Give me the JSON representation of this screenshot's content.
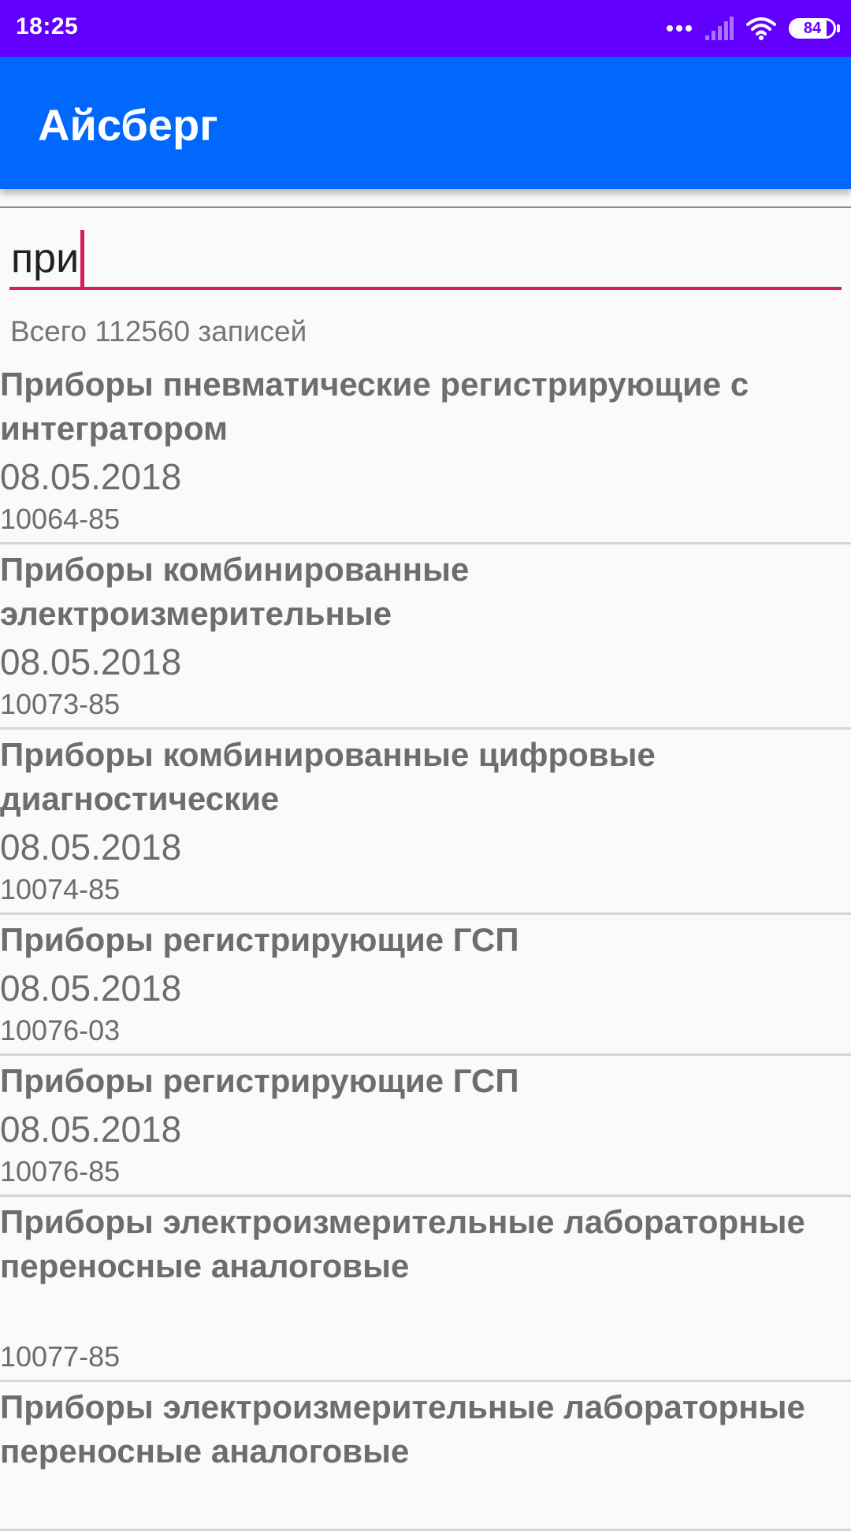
{
  "status_bar": {
    "time": "18:25",
    "battery": "84",
    "battery_level": 0.84,
    "icons": [
      "more-dots-icon",
      "signal-icon",
      "wifi-icon",
      "battery-icon"
    ]
  },
  "app_bar": {
    "title": "Айсберг"
  },
  "search": {
    "value": "при"
  },
  "results": {
    "total_label": "Всего 112560 записей"
  },
  "items": [
    {
      "title": "Приборы пневматические регистрирующие с интегратором",
      "date": "08.05.2018",
      "code": "10064-85"
    },
    {
      "title": "Приборы комбинированные электроизмерительные",
      "date": "08.05.2018",
      "code": "10073-85"
    },
    {
      "title": "Приборы комбинированные цифровые диагностические",
      "date": "08.05.2018",
      "code": "10074-85"
    },
    {
      "title": "Приборы регистрирующие ГСП",
      "date": "08.05.2018",
      "code": "10076-03"
    },
    {
      "title": "Приборы регистрирующие ГСП",
      "date": "08.05.2018",
      "code": "10076-85"
    },
    {
      "title": "Приборы электроизмерительные лабораторные переносные аналоговые",
      "date": "",
      "code": "10077-85"
    },
    {
      "title": "Приборы электроизмерительные лабораторные переносные аналоговые",
      "date": "",
      "code": ""
    }
  ],
  "colors": {
    "status_bar": "#6200ff",
    "app_bar": "#0068ff",
    "accent": "#d81b60",
    "text_secondary": "#6d6d6d"
  }
}
